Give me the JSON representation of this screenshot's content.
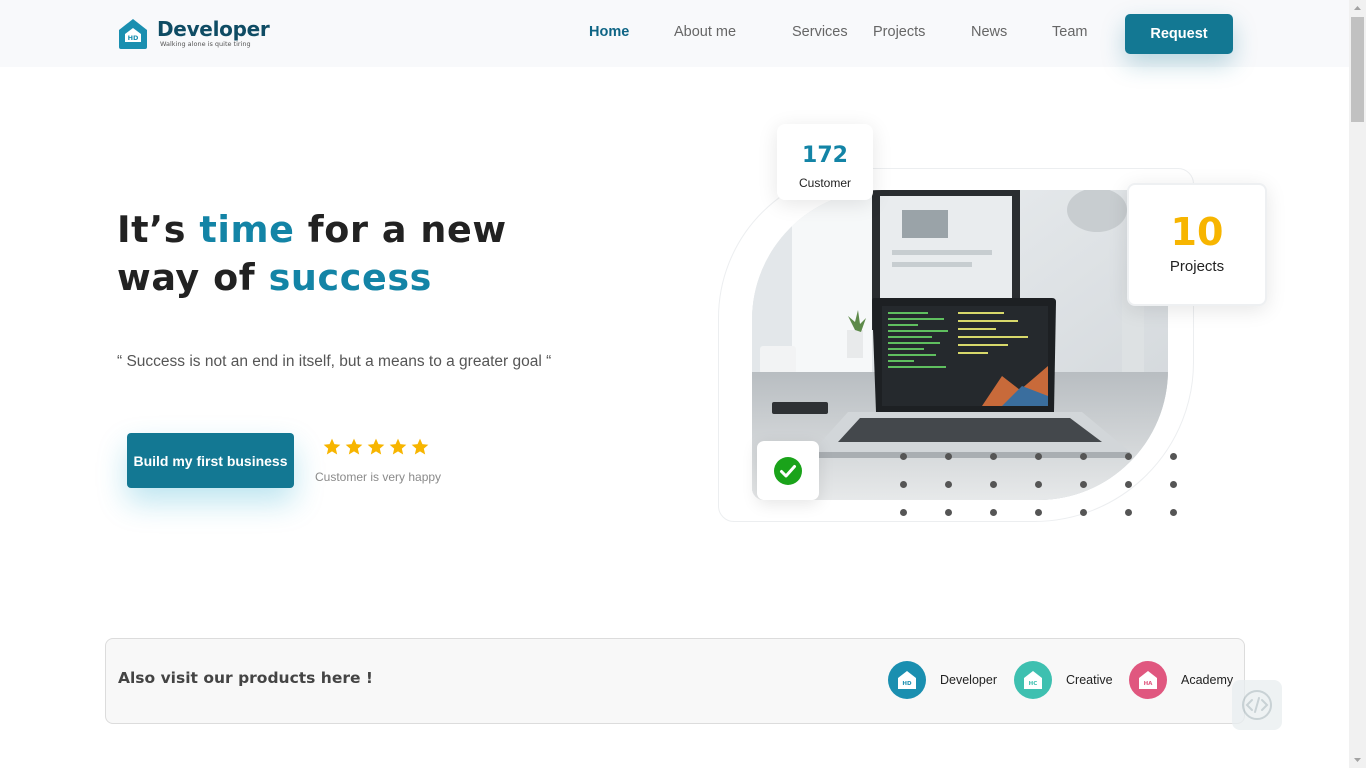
{
  "header": {
    "logo_title": "Developer",
    "logo_subtitle": "Walking alone is quite tiring",
    "logo_badge": "HD",
    "nav": [
      {
        "label": "Home",
        "active": true
      },
      {
        "label": "About me",
        "active": false
      },
      {
        "label": "Services",
        "active": false
      },
      {
        "label": "Projects",
        "active": false
      },
      {
        "label": "News",
        "active": false
      },
      {
        "label": "Team",
        "active": false
      }
    ],
    "request_label": "Request"
  },
  "hero": {
    "title_part1": "It’s ",
    "title_highlight1": "time",
    "title_part2": " for a new",
    "title_part3": "way of ",
    "title_highlight2": "success",
    "quote": "“ Success is not an end in itself, but a means to a greater goal “",
    "cta_label": "Build my first business",
    "rating_stars": 5,
    "rating_caption": "Customer is very happy"
  },
  "stats": {
    "customer_value": "172",
    "customer_label": "Customer",
    "projects_value": "10",
    "projects_label": "Projects"
  },
  "products": {
    "title": "Also visit our products here !",
    "items": [
      {
        "name": "Developer",
        "badge": "HD",
        "color": "#1a8fb0"
      },
      {
        "name": "Creative",
        "badge": "HC",
        "color": "#3ec0b0"
      },
      {
        "name": "Academy",
        "badge": "HA",
        "color": "#e0577f"
      }
    ]
  },
  "colors": {
    "primary": "#137893",
    "accent_text": "#1384a6",
    "star": "#f7b500",
    "check": "#1aa31a"
  }
}
